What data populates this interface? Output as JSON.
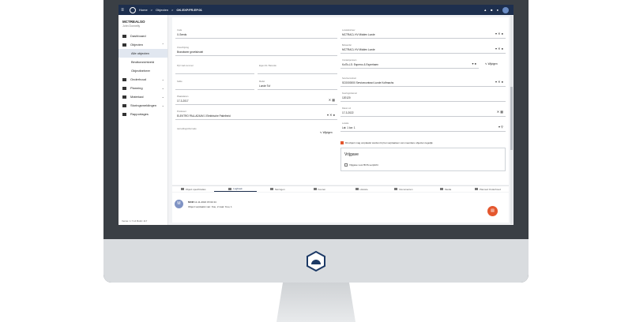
{
  "topbar": {
    "menu_icon": "hamburger-icon",
    "crumbs": [
      "Home",
      "Objecten",
      "OK.EXP.FR.EP.01"
    ],
    "crumb_sep": ">",
    "subtitle": "OK.EXP.FR.EP.01 · Brandweer gevelsleutel"
  },
  "sidebar": {
    "app_title": "MCTREALSO",
    "user": "John Donnelly",
    "items": [
      {
        "label": "Dashboard",
        "icon": "dashboard-icon"
      },
      {
        "label": "Objecten",
        "icon": "objects-icon"
      },
      {
        "label": "Alle objecten",
        "sub": true,
        "active": true
      },
      {
        "label": "Bindtoezichtveld",
        "sub": true
      },
      {
        "label": "Objectbeheer",
        "sub": true
      },
      {
        "label": "Onderhoud",
        "icon": "wrench-icon"
      },
      {
        "label": "Planning",
        "icon": "calendar-icon"
      },
      {
        "label": "Materiaal",
        "icon": "box-icon"
      },
      {
        "label": "Storingsmeldingen",
        "icon": "alert-icon"
      },
      {
        "label": "Rapportages",
        "icon": "report-icon"
      }
    ],
    "version": "Versie: 1.7.14 Build: 117"
  },
  "form": {
    "fields": [
      {
        "label": "Code",
        "value": "X-Seeds"
      },
      {
        "label": "Omschrijving",
        "value": "Brandweer gevelsleutel"
      },
      {
        "label": "Plaatsbepaling",
        "value": "Werfstraat"
      },
      {
        "label": "Pijl / Gab nummer",
        "value": ""
      },
      {
        "label": "Eigen ID / Barcode",
        "value": ""
      },
      {
        "label": "Kable",
        "value": ""
      },
      {
        "label": "Model",
        "value": "Lunde Tuf"
      },
      {
        "label": "Plaatsdatum",
        "value": "17-3-2017"
      },
      {
        "label": "Producent",
        "value": "ELEKTRO PALLADIUM 1 Elektrische Patielheid"
      },
      {
        "label": "Aanvullingsinformatie",
        "value": ""
      },
      {
        "label": "Locatiebeheer",
        "value": "MCTRACL HV Midden Lunde"
      },
      {
        "label": "Beheerder",
        "value": "MCTRACL HV Midden Lunde"
      },
      {
        "label": "Contactpersoon",
        "value": "KolTo-LS: Esperno & Esperhaen"
      },
      {
        "label": "Servicecontract",
        "value": "SC0000000 Servicecontract Lunde Kolfmachs"
      },
      {
        "label": "Keuringsinterval",
        "value": "120120"
      },
      {
        "label": "Datum uit",
        "value": "17-3-2022"
      },
      {
        "label": "Locatie",
        "value": "Lat: 1 lon: 1"
      }
    ],
    "wijzigen_label": "Wijzigen",
    "wijzigen_label2": "Wijzigen",
    "warning_text": "Dit object mag verplaatst worden bij het verplaatsen van meerdere objecten tegelijk.",
    "release": {
      "title": "Vrijgave",
      "checkbox_label": "Vrijgave voor BOS-verplicht"
    }
  },
  "tabs": [
    {
      "label": "Object specificaties",
      "active": false
    },
    {
      "label": "Logboek",
      "active": true
    },
    {
      "label": "Storingen",
      "active": false
    },
    {
      "label": "Keuren",
      "active": false
    },
    {
      "label": "Historie",
      "active": false
    },
    {
      "label": "Documenten",
      "active": false
    },
    {
      "label": "Media",
      "active": false
    },
    {
      "label": "Planned Onderhoud",
      "active": false
    }
  ],
  "log": {
    "avatar_letter": "M",
    "author": "MCM",
    "timestamp": "12-11-2022 15:02:44",
    "message": "Object verplaatst van: Kou, 2 naar: Kou, 1"
  },
  "colors": {
    "topbar": "#1d2f4e",
    "accent": "#e4572e"
  }
}
